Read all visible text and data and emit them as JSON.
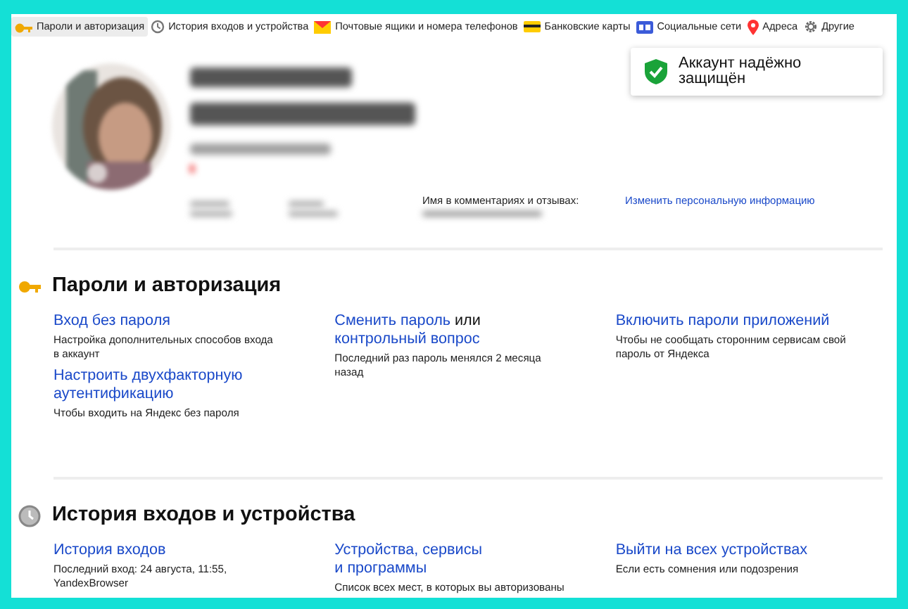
{
  "tabs": [
    {
      "label": "Пароли и авторизация",
      "selected": true
    },
    {
      "label": "История входов и устройства",
      "selected": false
    },
    {
      "label": "Почтовые ящики и номера телефонов",
      "selected": false
    },
    {
      "label": "Банковские карты",
      "selected": false
    },
    {
      "label": "Социальные сети",
      "selected": false
    },
    {
      "label": "Адреса",
      "selected": false
    },
    {
      "label": "Другие",
      "selected": false
    }
  ],
  "profile": {
    "comment_name_label": "Имя в комментариях и отзывах:",
    "edit_link": "Изменить персональную информацию"
  },
  "security_badge": {
    "text": "Аккаунт надёжно\nзащищён"
  },
  "sections": [
    {
      "title": "Пароли и авторизация",
      "columns": [
        [
          {
            "title": [
              {
                "text": "Вход без пароля",
                "link": true
              }
            ],
            "description": "Настройка дополнительных способов входа\nв аккаунт"
          },
          {
            "title": [
              {
                "text": "Настроить двухфакторную\nаутентификацию",
                "link": true
              }
            ],
            "description": "Чтобы входить на Яндекс без пароля"
          }
        ],
        [
          {
            "title": [
              {
                "text": "Сменить пароль",
                "link": true
              },
              {
                "text": "или",
                "link": false
              },
              {
                "text": "контрольный вопрос",
                "link": true
              }
            ],
            "description": "Последний раз пароль менялся 2 месяца\nназад"
          }
        ],
        [
          {
            "title": [
              {
                "text": "Включить пароли приложений",
                "link": true
              }
            ],
            "description": "Чтобы не сообщать сторонним сервисам свой\nпароль от Яндекса"
          }
        ]
      ]
    },
    {
      "title": "История входов и устройства",
      "columns": [
        [
          {
            "title": [
              {
                "text": "История входов",
                "link": true
              }
            ],
            "description": "Последний вход: 24 августа, 11:55,\nYandexBrowser"
          }
        ],
        [
          {
            "title": [
              {
                "text": "Устройства, сервисы\nи программы",
                "link": true
              }
            ],
            "description": "Список всех мест, в которых вы авторизованы"
          }
        ],
        [
          {
            "title": [
              {
                "text": "Выйти на всех устройствах",
                "link": true
              }
            ],
            "description": "Если есть сомнения или подозрения"
          }
        ]
      ]
    }
  ]
}
